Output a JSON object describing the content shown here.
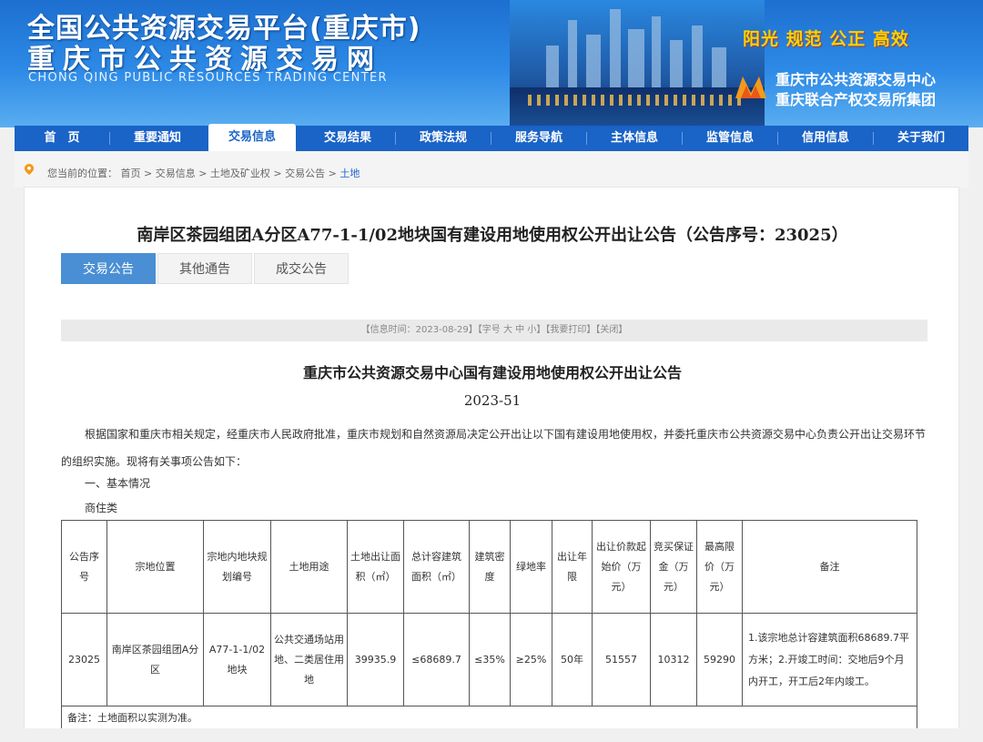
{
  "header": {
    "title_cn": "全国公共资源交易平台(重庆市)",
    "title_cn2": "重庆市公共资源交易网",
    "title_en": "CHONG QING PUBLIC RESOURCES TRADING CENTER",
    "slogan": "阳光 规范 公正 高效",
    "org_line1": "重庆市公共资源交易中心",
    "org_line2": "重庆联合产权交易所集团"
  },
  "nav": {
    "items": [
      "首　页",
      "重要通知",
      "交易信息",
      "交易结果",
      "政策法规",
      "服务导航",
      "主体信息",
      "监管信息",
      "信用信息",
      "关于我们"
    ],
    "active_index": 2
  },
  "breadcrumb": {
    "prefix": "您当前的位置：",
    "path": "首页 > 交易信息 > 土地及矿业权 > 交易公告 > ",
    "current": "土地"
  },
  "document": {
    "title": "南岸区茶园组团A分区A77-1-1/02地块国有建设用地使用权公开出让公告（公告序号：23025）",
    "tabs": [
      "交易公告",
      "其他通告",
      "成交公告"
    ],
    "active_tab": 0,
    "info_bar": "【信息时间：2023-08-29】【字号 大 中 小】【我要打印】【关闭】",
    "sub_title": "重庆市公共资源交易中心国有建设用地使用权公开出让公告",
    "sub_no": "2023-51",
    "paragraph": "根据国家和重庆市相关规定，经重庆市人民政府批准，重庆市规划和自然资源局决定公开出让以下国有建设用地使用权，并委托重庆市公共资源交易中心负责公开出让交易环节的组织实施。现将有关事项公告如下：",
    "section": "一、基本情况",
    "category": "商住类"
  },
  "table": {
    "headers": [
      "公告序号",
      "宗地位置",
      "宗地内地块规划编号",
      "土地用途",
      "土地出让面积（㎡）",
      "总计容建筑面积（㎡）",
      "建筑密度",
      "绿地率",
      "出让年限",
      "出让价款起始价（万元）",
      "竞买保证金（万元）",
      "最高限价（万元）",
      "备注"
    ],
    "row": [
      "23025",
      "南岸区茶园组团A分区",
      "A77-1-1/02地块",
      "公共交通场站用地、二类居住用地",
      "39935.9",
      "≤68689.7",
      "≤35%",
      "≥25%",
      "50年",
      "51557",
      "10312",
      "59290",
      "1.该宗地总计容建筑面积68689.7平方米；2.开竣工时间：交地后9个月内开工，开工后2年内竣工。"
    ],
    "footnote": "备注：土地面积以实测为准。"
  },
  "colors": {
    "nav_blue": "#1a63c7",
    "tab_active": "#4a8fd4",
    "slogan_yellow": "#f7d400"
  }
}
